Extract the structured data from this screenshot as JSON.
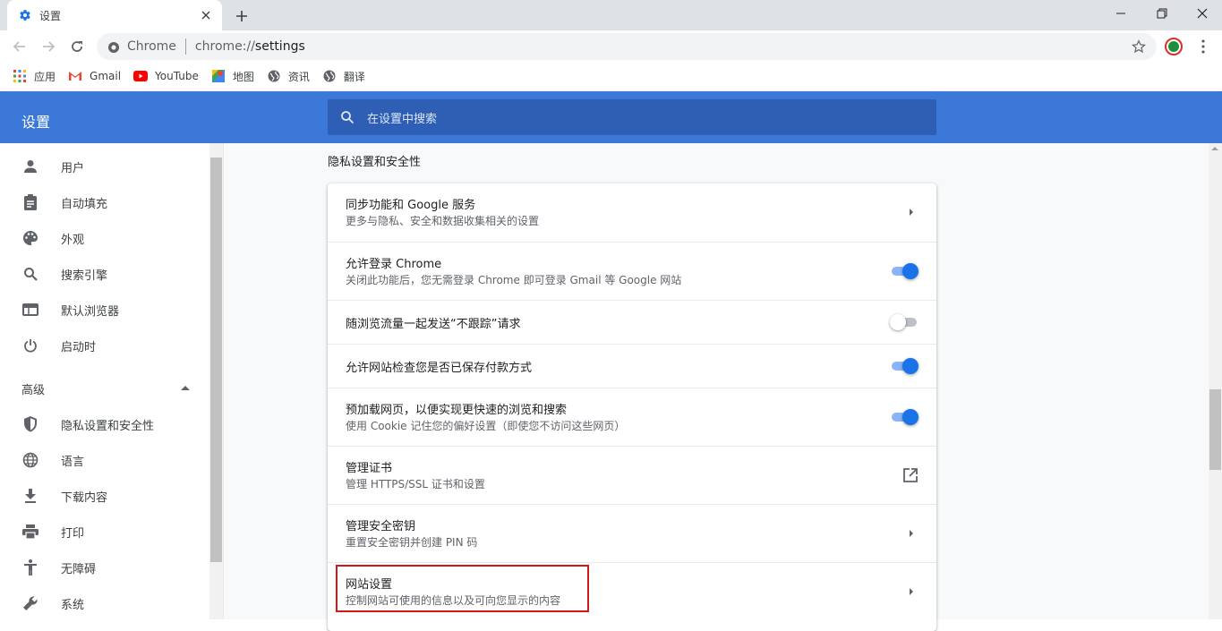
{
  "tab": {
    "title": "设置",
    "close_label": "×"
  },
  "omnibox": {
    "chip": "Chrome",
    "url_scheme": "chrome://",
    "url_path": "settings"
  },
  "bookmarks": [
    {
      "label": "应用",
      "icon": "apps-grid-icon"
    },
    {
      "label": "Gmail",
      "icon": "gmail-icon"
    },
    {
      "label": "YouTube",
      "icon": "youtube-icon"
    },
    {
      "label": "地图",
      "icon": "maps-icon"
    },
    {
      "label": "资讯",
      "icon": "globe-icon"
    },
    {
      "label": "翻译",
      "icon": "globe-icon"
    }
  ],
  "header": {
    "title": "设置",
    "search_placeholder": "在设置中搜索"
  },
  "sidebar": {
    "items": [
      {
        "label": "用户",
        "icon": "person-icon"
      },
      {
        "label": "自动填充",
        "icon": "clipboard-icon"
      },
      {
        "label": "外观",
        "icon": "palette-icon"
      },
      {
        "label": "搜索引擎",
        "icon": "search-icon"
      },
      {
        "label": "默认浏览器",
        "icon": "browser-icon"
      },
      {
        "label": "启动时",
        "icon": "power-icon"
      }
    ],
    "advanced_label": "高级",
    "advanced_items": [
      {
        "label": "隐私设置和安全性",
        "icon": "shield-icon"
      },
      {
        "label": "语言",
        "icon": "globe-icon"
      },
      {
        "label": "下载内容",
        "icon": "download-icon"
      },
      {
        "label": "打印",
        "icon": "printer-icon"
      },
      {
        "label": "无障碍",
        "icon": "accessibility-icon"
      },
      {
        "label": "系统",
        "icon": "wrench-icon"
      }
    ]
  },
  "main": {
    "section_title": "隐私设置和安全性",
    "rows": [
      {
        "title": "同步功能和 Google 服务",
        "subtitle": "更多与隐私、安全和数据收集相关的设置",
        "control": "arrow"
      },
      {
        "title": "允许登录 Chrome",
        "subtitle": "关闭此功能后，您无需登录 Chrome 即可登录 Gmail 等 Google 网站",
        "control": "toggle",
        "on": true
      },
      {
        "title": "随浏览流量一起发送“不跟踪”请求",
        "subtitle": "",
        "control": "toggle",
        "on": false
      },
      {
        "title": "允许网站检查您是否已保存付款方式",
        "subtitle": "",
        "control": "toggle",
        "on": true
      },
      {
        "title": "预加载网页，以便实现更快速的浏览和搜索",
        "subtitle": "使用 Cookie 记住您的偏好设置（即使您不访问这些网页）",
        "control": "toggle",
        "on": true
      },
      {
        "title": "管理证书",
        "subtitle": "管理 HTTPS/SSL 证书和设置",
        "control": "external"
      },
      {
        "title": "管理安全密钥",
        "subtitle": "重置安全密钥并创建 PIN 码",
        "control": "arrow"
      },
      {
        "title": "网站设置",
        "subtitle": "控制网站可使用的信息以及可向您显示的内容",
        "control": "arrow"
      }
    ]
  },
  "colors": {
    "header_bg": "#3c78d8",
    "toggle_on": "#1a73e8",
    "highlight_border": "#d0191b"
  }
}
